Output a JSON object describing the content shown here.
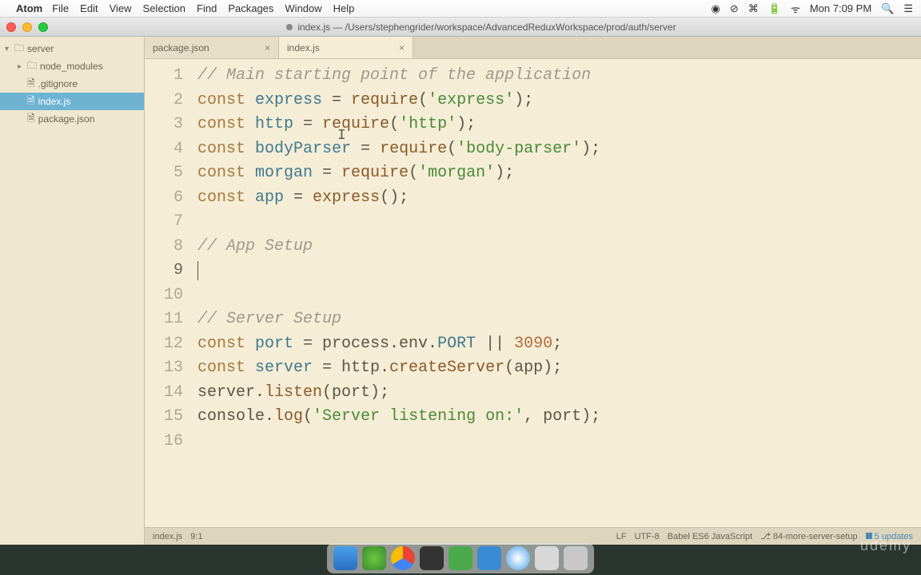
{
  "menubar": {
    "appname": "Atom",
    "menus": [
      "File",
      "Edit",
      "View",
      "Selection",
      "Find",
      "Packages",
      "Window",
      "Help"
    ],
    "clock": "Mon 7:09 PM"
  },
  "titlebar": {
    "title": "index.js — /Users/stephengrider/workspace/AdvancedReduxWorkspace/prod/auth/server"
  },
  "sidebar": {
    "root": "server",
    "items": [
      {
        "name": "node_modules",
        "type": "folder"
      },
      {
        "name": ".gitignore",
        "type": "file"
      },
      {
        "name": "index.js",
        "type": "file",
        "selected": true
      },
      {
        "name": "package.json",
        "type": "file"
      }
    ]
  },
  "tabs": [
    {
      "label": "package.json",
      "active": false
    },
    {
      "label": "index.js",
      "active": true
    }
  ],
  "code": {
    "lines": [
      [
        {
          "t": "comment",
          "v": "// Main starting point of the application"
        }
      ],
      [
        {
          "t": "kw",
          "v": "const "
        },
        {
          "t": "var",
          "v": "express"
        },
        {
          "t": "punct",
          "v": " = "
        },
        {
          "t": "func",
          "v": "require"
        },
        {
          "t": "punct",
          "v": "("
        },
        {
          "t": "str",
          "v": "'express'"
        },
        {
          "t": "punct",
          "v": ");"
        }
      ],
      [
        {
          "t": "kw",
          "v": "const "
        },
        {
          "t": "var",
          "v": "http"
        },
        {
          "t": "punct",
          "v": " = "
        },
        {
          "t": "func",
          "v": "require"
        },
        {
          "t": "punct",
          "v": "("
        },
        {
          "t": "str",
          "v": "'http'"
        },
        {
          "t": "punct",
          "v": ");"
        }
      ],
      [
        {
          "t": "kw",
          "v": "const "
        },
        {
          "t": "var",
          "v": "bodyParser"
        },
        {
          "t": "punct",
          "v": " = "
        },
        {
          "t": "func",
          "v": "require"
        },
        {
          "t": "punct",
          "v": "("
        },
        {
          "t": "str",
          "v": "'body-parser'"
        },
        {
          "t": "punct",
          "v": ");"
        }
      ],
      [
        {
          "t": "kw",
          "v": "const "
        },
        {
          "t": "var",
          "v": "morgan"
        },
        {
          "t": "punct",
          "v": " = "
        },
        {
          "t": "func",
          "v": "require"
        },
        {
          "t": "punct",
          "v": "("
        },
        {
          "t": "str",
          "v": "'morgan'"
        },
        {
          "t": "punct",
          "v": ");"
        }
      ],
      [
        {
          "t": "kw",
          "v": "const "
        },
        {
          "t": "var",
          "v": "app"
        },
        {
          "t": "punct",
          "v": " = "
        },
        {
          "t": "func",
          "v": "express"
        },
        {
          "t": "punct",
          "v": "();"
        }
      ],
      [],
      [
        {
          "t": "comment",
          "v": "// App Setup"
        }
      ],
      [],
      [],
      [
        {
          "t": "comment",
          "v": "// Server Setup"
        }
      ],
      [
        {
          "t": "kw",
          "v": "const "
        },
        {
          "t": "var",
          "v": "port"
        },
        {
          "t": "punct",
          "v": " = process.env."
        },
        {
          "t": "prop",
          "v": "PORT"
        },
        {
          "t": "punct",
          "v": " || "
        },
        {
          "t": "num",
          "v": "3090"
        },
        {
          "t": "punct",
          "v": ";"
        }
      ],
      [
        {
          "t": "kw",
          "v": "const "
        },
        {
          "t": "var",
          "v": "server"
        },
        {
          "t": "punct",
          "v": " = http."
        },
        {
          "t": "member",
          "v": "createServer"
        },
        {
          "t": "punct",
          "v": "(app);"
        }
      ],
      [
        {
          "t": "punct",
          "v": "server."
        },
        {
          "t": "member",
          "v": "listen"
        },
        {
          "t": "punct",
          "v": "(port);"
        }
      ],
      [
        {
          "t": "punct",
          "v": "console."
        },
        {
          "t": "member",
          "v": "log"
        },
        {
          "t": "punct",
          "v": "("
        },
        {
          "t": "str",
          "v": "'Server listening on:'"
        },
        {
          "t": "punct",
          "v": ", port);"
        }
      ],
      []
    ],
    "current_line_index": 8
  },
  "statusbar": {
    "file": "index.js",
    "cursor": "9:1",
    "eol": "LF",
    "encoding": "UTF-8",
    "grammar": "Babel ES6 JavaScript",
    "branch_icon": "⎇",
    "branch": "84-more-server-setup",
    "updates": "5 updates"
  },
  "watermark": "udemy"
}
